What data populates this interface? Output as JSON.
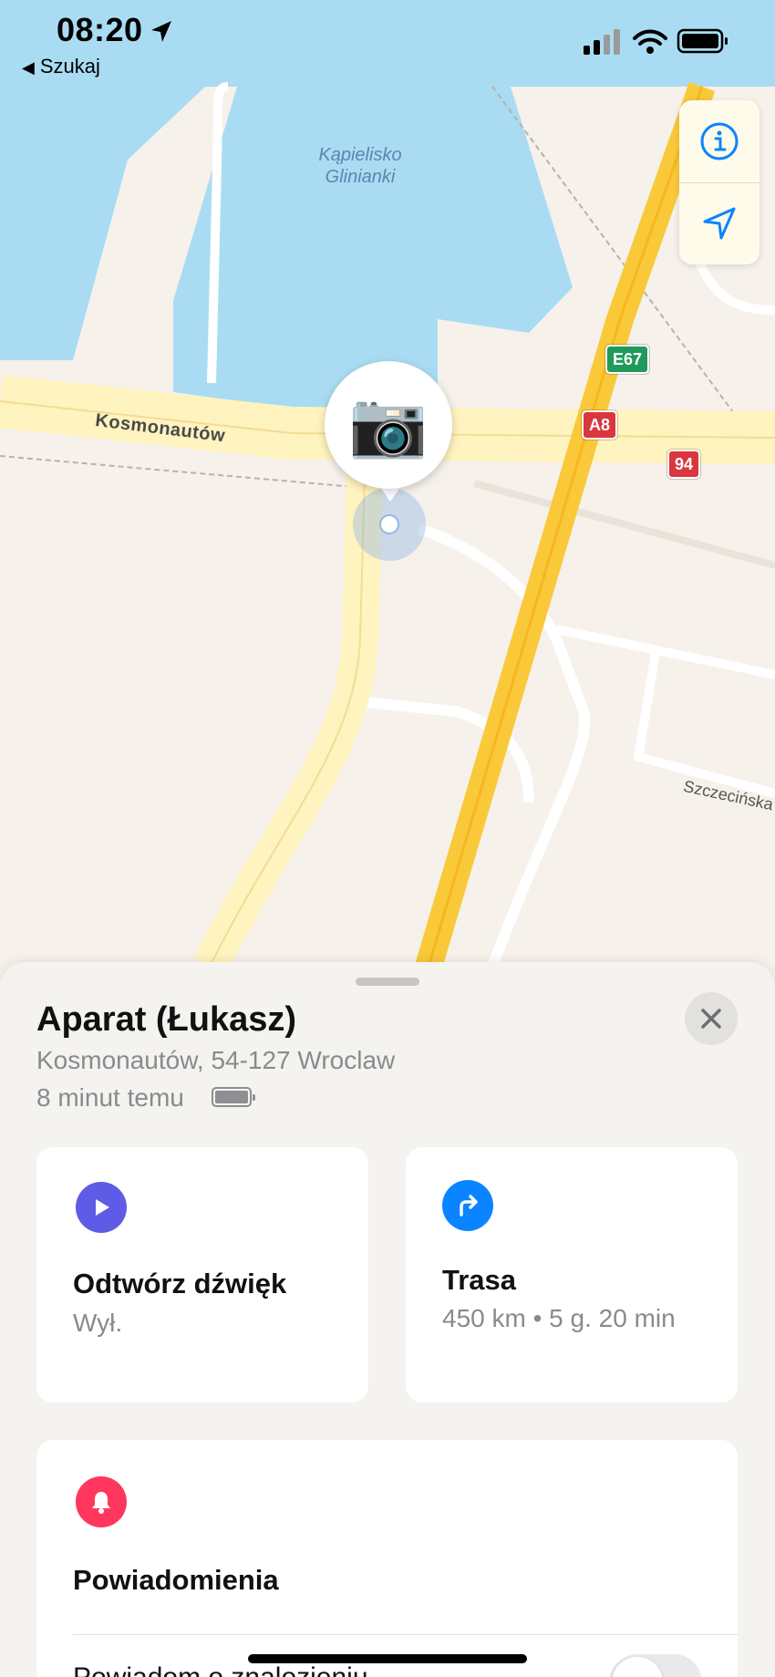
{
  "status_bar": {
    "time": "08:20",
    "back_label": "Szukaj",
    "location_icon": "location-arrow-icon",
    "signal_icon": "cellular-signal-icon",
    "wifi_icon": "wifi-icon",
    "battery_icon": "battery-icon"
  },
  "map": {
    "water_label": "Kąpielisko Glinianki",
    "road_labels": [
      "Kosmonautów",
      "Szczecińska"
    ],
    "shields": [
      {
        "label": "E67",
        "color": "#1f9a5b"
      },
      {
        "label": "A8",
        "color": "#d9363e"
      },
      {
        "label": "94",
        "color": "#d9363e"
      }
    ],
    "pin_emoji": "📷",
    "buttons": {
      "info_icon": "info-icon",
      "locate_icon": "navigation-arrow-icon"
    },
    "colors": {
      "water": "#a9dcf2",
      "land": "#f6f1ea",
      "highway": "#f9c93a",
      "road": "#fff3bf"
    }
  },
  "sheet": {
    "title": "Aparat (Łukasz)",
    "address": "Kosmonautów, 54-127 Wroclaw",
    "time_ago": "8 minut temu",
    "close_icon": "close-icon",
    "actions": [
      {
        "icon": "play-icon",
        "title": "Odtwórz dźwięk",
        "subtitle": "Wył.",
        "color": "#5e5ce6"
      },
      {
        "icon": "directions-icon",
        "title": "Trasa",
        "subtitle": "450 km • 5 g. 20 min",
        "color": "#0a84ff"
      }
    ],
    "notifications": {
      "icon": "bell-icon",
      "title": "Powiadomienia",
      "color": "#ff375f",
      "row_label": "Powiadom o znalezieniu",
      "toggle_on": false
    }
  }
}
